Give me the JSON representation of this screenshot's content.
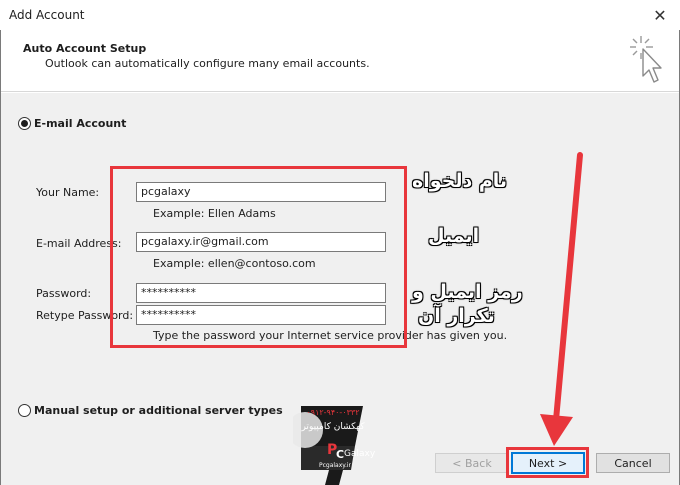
{
  "window": {
    "title": "Add Account",
    "close_glyph": "✕"
  },
  "header": {
    "title": "Auto Account Setup",
    "subtitle": "Outlook can automatically configure many email accounts."
  },
  "email_option": {
    "label": "E-mail Account",
    "selected": true
  },
  "form": {
    "name_label": "Your Name:",
    "name_value": "pcgalaxy",
    "name_hint": "Example: Ellen Adams",
    "email_label": "E-mail Address:",
    "email_value": "pcgalaxy.ir@gmail.com",
    "email_hint": "Example: ellen@contoso.com",
    "password_label": "Password:",
    "password_value": "**********",
    "retype_label": "Retype Password:",
    "retype_value": "**********",
    "password_hint": "Type the password your Internet service provider has given you."
  },
  "annotations": {
    "name_note": "نام دلخواه",
    "email_note": "ایمیل",
    "password_note_1": "رمز ایمیل و",
    "password_note_2": "تکرار آن",
    "accent_color": "#e8363c"
  },
  "manual_option": {
    "label": "Manual setup or additional server types",
    "selected": false
  },
  "watermark": {
    "phone": "۰۹۱۲-۹۴۰-۰۳۳۲",
    "brand_fa": "کهکشان کامپیوتر",
    "brand_p": "P",
    "brand_c": "C",
    "brand_rest": "Galaxy",
    "site": "Pcgalaxy.ir"
  },
  "buttons": {
    "back": "< Back",
    "next": "Next >",
    "cancel": "Cancel"
  }
}
